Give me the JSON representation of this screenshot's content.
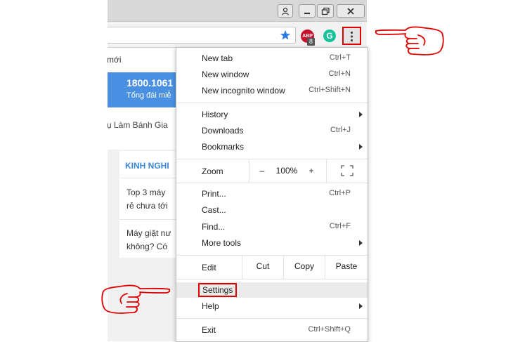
{
  "page": {
    "link_fragment": "mới",
    "banner": {
      "phone": "1800.1061",
      "subtitle": "Tổng đài miễ"
    },
    "nav_fragment": "ụ Làm Bánh Gia",
    "card": {
      "heading": "KINH NGHI",
      "item1": [
        "Top 3 máy",
        "rẻ chưa tới"
      ],
      "item2": [
        "Máy giặt nư",
        "không? Có"
      ]
    }
  },
  "toolbar": {
    "abp_badge": "8",
    "abp_label": "ABP"
  },
  "menu": {
    "group1": [
      {
        "label": "New tab",
        "shortcut": "Ctrl+T"
      },
      {
        "label": "New window",
        "shortcut": "Ctrl+N"
      },
      {
        "label": "New incognito window",
        "shortcut": "Ctrl+Shift+N"
      }
    ],
    "group2": [
      {
        "label": "History",
        "shortcut": ""
      },
      {
        "label": "Downloads",
        "shortcut": "Ctrl+J"
      },
      {
        "label": "Bookmarks",
        "shortcut": ""
      }
    ],
    "zoom": {
      "label": "Zoom",
      "minus": "–",
      "value": "100%",
      "plus": "+"
    },
    "group3": [
      {
        "label": "Print...",
        "shortcut": "Ctrl+P"
      },
      {
        "label": "Cast...",
        "shortcut": ""
      },
      {
        "label": "Find...",
        "shortcut": "Ctrl+F"
      },
      {
        "label": "More tools",
        "shortcut": ""
      }
    ],
    "edit": {
      "label": "Edit",
      "cut": "Cut",
      "copy": "Copy",
      "paste": "Paste"
    },
    "group4": [
      {
        "label": "Settings",
        "shortcut": ""
      },
      {
        "label": "Help",
        "shortcut": ""
      }
    ],
    "exit": {
      "label": "Exit",
      "shortcut": "Ctrl+Shift+Q"
    }
  },
  "colors": {
    "banner_blue": "#4a90e2",
    "highlight_red": "#e00000",
    "card_heading_blue": "#3a86d8"
  }
}
